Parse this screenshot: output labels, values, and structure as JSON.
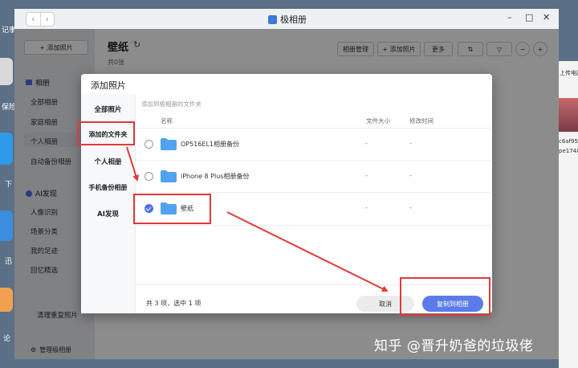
{
  "desktop": {
    "labels": [
      "记事",
      "保险",
      "下",
      "迅",
      "论"
    ],
    "right_texts": [
      "上传电脑",
      "c6af95",
      "pe1748"
    ]
  },
  "window": {
    "title": "极相册",
    "nav_back": "‹",
    "nav_fwd": "›",
    "minimize": "–",
    "maximize": "□",
    "close": "✕"
  },
  "sidebar": {
    "add_photo": "+ 添加照片",
    "albums_head": "相册",
    "items": [
      "全部相册",
      "家庭相册",
      "个人相册",
      "自动备份相册"
    ],
    "ai_head": "AI发现",
    "ai_items": [
      "人像识别",
      "场景分类",
      "我的足迹",
      "回忆精选"
    ],
    "cleanup": "清理重复照片",
    "manage": "管理极相册"
  },
  "main": {
    "title": "壁纸",
    "count": "共0张",
    "toolbar": [
      "相册管理",
      "+ 添加照片",
      "更多"
    ]
  },
  "dialog": {
    "title": "添加照片",
    "tabs": [
      "全部照片",
      "添加的文件夹",
      "个人相册",
      "手机备份相册",
      "AI发现"
    ],
    "breadcrumb": "添加到极相册的文件夹",
    "columns": {
      "name": "名称",
      "size": "文件大小",
      "time": "修改时间"
    },
    "rows": [
      {
        "name": "OP516EL1相册备份",
        "size": "-",
        "time": "-",
        "selected": false
      },
      {
        "name": "iPhone 8 Plus相册备份",
        "size": "-",
        "time": "-",
        "selected": false
      },
      {
        "name": "壁纸",
        "size": "-",
        "time": "-",
        "selected": true
      }
    ],
    "footer_text": "共 3 项，选中 1 项",
    "cancel_label": "取消",
    "copy_label": "复制到相册"
  },
  "watermark": "知乎 @晋升奶爸的垃圾佬",
  "colors": {
    "accent": "#5b7bea",
    "annotation": "#e03a3a",
    "folder": "#4fa3ef"
  }
}
